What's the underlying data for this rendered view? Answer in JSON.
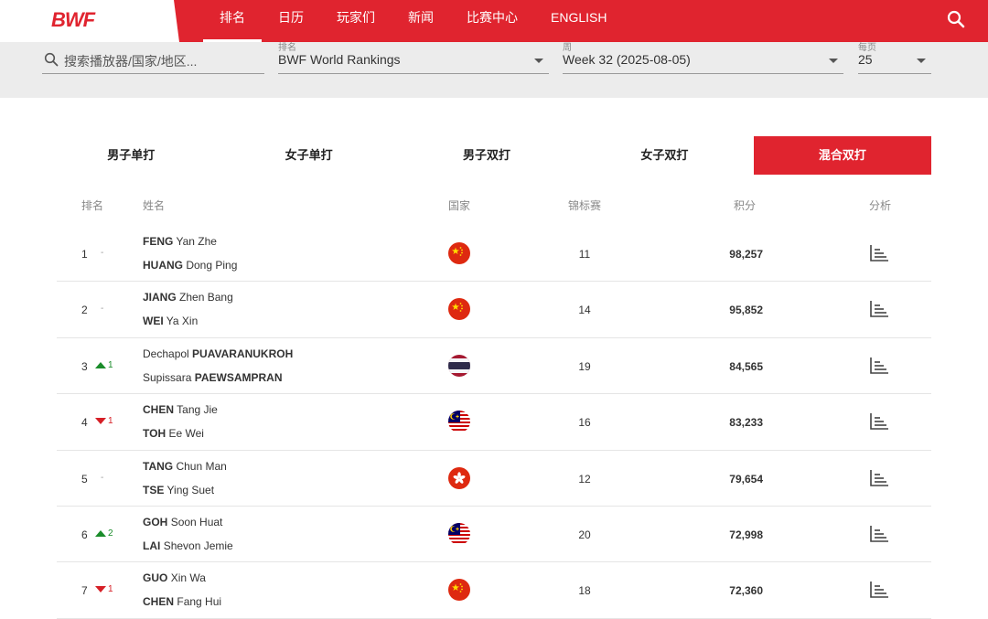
{
  "header": {
    "logo": "BWF",
    "nav": [
      "排名",
      "日历",
      "玩家们",
      "新闻",
      "比赛中心",
      "ENGLISH"
    ]
  },
  "filters": {
    "search_placeholder": "搜索播放器/国家/地区...",
    "ranking_label": "排名",
    "ranking_value": "BWF World Rankings",
    "week_label": "周",
    "week_value": "Week 32 (2025-08-05)",
    "perpage_label": "每页",
    "perpage_value": "25"
  },
  "tabs": [
    "男子单打",
    "女子单打",
    "男子双打",
    "女子双打",
    "混合双打"
  ],
  "active_tab_index": 4,
  "table": {
    "headers": [
      "排名",
      "姓名",
      "国家",
      "锦标赛",
      "积分",
      "分析"
    ],
    "rows": [
      {
        "rank": "1",
        "change": "-",
        "dir": "same",
        "p1_last": "FENG",
        "p1_first": "Yan Zhe",
        "p2_last": "HUANG",
        "p2_first": "Dong Ping",
        "country": "china",
        "tournaments": "11",
        "points": "98,257"
      },
      {
        "rank": "2",
        "change": "-",
        "dir": "same",
        "p1_last": "JIANG",
        "p1_first": "Zhen Bang",
        "p2_last": "WEI",
        "p2_first": "Ya Xin",
        "country": "china",
        "tournaments": "14",
        "points": "95,852"
      },
      {
        "rank": "3",
        "change": "1",
        "dir": "up",
        "p1_first": "Dechapol",
        "p1_last": "PUAVARANUKROH",
        "p2_first": "Supissara",
        "p2_last": "PAEWSAMPRAN",
        "first_first": true,
        "country": "thailand",
        "tournaments": "19",
        "points": "84,565"
      },
      {
        "rank": "4",
        "change": "1",
        "dir": "down",
        "p1_last": "CHEN",
        "p1_first": "Tang Jie",
        "p2_last": "TOH",
        "p2_first": "Ee Wei",
        "country": "malaysia",
        "tournaments": "16",
        "points": "83,233"
      },
      {
        "rank": "5",
        "change": "-",
        "dir": "same",
        "p1_last": "TANG",
        "p1_first": "Chun Man",
        "p2_last": "TSE",
        "p2_first": "Ying Suet",
        "country": "hongkong",
        "tournaments": "12",
        "points": "79,654"
      },
      {
        "rank": "6",
        "change": "2",
        "dir": "up",
        "p1_last": "GOH",
        "p1_first": "Soon Huat",
        "p2_last": "LAI",
        "p2_first": "Shevon Jemie",
        "country": "malaysia",
        "tournaments": "20",
        "points": "72,998"
      },
      {
        "rank": "7",
        "change": "1",
        "dir": "down",
        "p1_last": "GUO",
        "p1_first": "Xin Wa",
        "p2_last": "CHEN",
        "p2_first": "Fang Hui",
        "country": "china",
        "tournaments": "18",
        "points": "72,360"
      }
    ]
  },
  "colors": {
    "brand_red": "#e0242f",
    "up_green": "#1a8c2a",
    "down_red": "#d61f26"
  },
  "icons": {
    "search": "search-icon",
    "analysis": "bar-chart-icon",
    "dropdown": "chevron-down-icon"
  }
}
